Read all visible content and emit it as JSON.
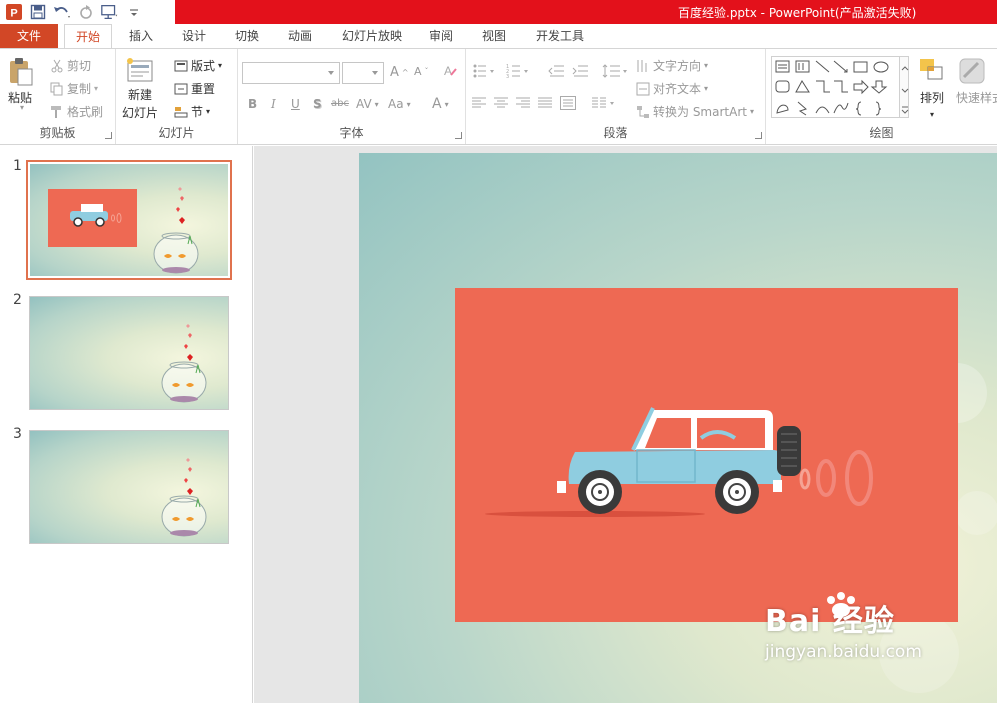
{
  "window": {
    "title": "百度经验.pptx -   PowerPoint(产品激活失败)"
  },
  "tabs": {
    "file": "文件",
    "items": [
      "开始",
      "插入",
      "设计",
      "切换",
      "动画",
      "幻灯片放映",
      "审阅",
      "视图",
      "开发工具"
    ],
    "active": "开始"
  },
  "ribbon": {
    "clipboard": {
      "paste": "粘贴",
      "cut": "剪切",
      "copy": "复制",
      "format_painter": "格式刷",
      "label": "剪贴板"
    },
    "slides": {
      "new_slide_line1": "新建",
      "new_slide_line2": "幻灯片",
      "layout": "版式",
      "reset": "重置",
      "section": "节",
      "label": "幻灯片"
    },
    "font": {
      "label": "字体",
      "bold": "B",
      "italic": "I",
      "underline": "U",
      "shadow": "S",
      "strikethrough": "abc",
      "spacing": "AV",
      "case": "Aa",
      "grow": "A",
      "color": "A"
    },
    "paragraph": {
      "text_direction": "文字方向",
      "align_text": "对齐文本",
      "smartart": "转换为 SmartArt",
      "label": "段落"
    },
    "drawing": {
      "arrange": "排列",
      "quick_styles": "快速样式",
      "label": "绘图"
    }
  },
  "slides_panel": {
    "numbers": [
      "1",
      "2",
      "3"
    ],
    "selected": 1
  },
  "watermark": {
    "brand": "Bai  经验",
    "url": "jingyan.baidu.com"
  },
  "colors": {
    "accent": "#d24726",
    "titlebar": "#e3111b",
    "slide_red_box": "#ee6953",
    "car_body": "#8fcde0",
    "selection_border": "#e0724e"
  }
}
